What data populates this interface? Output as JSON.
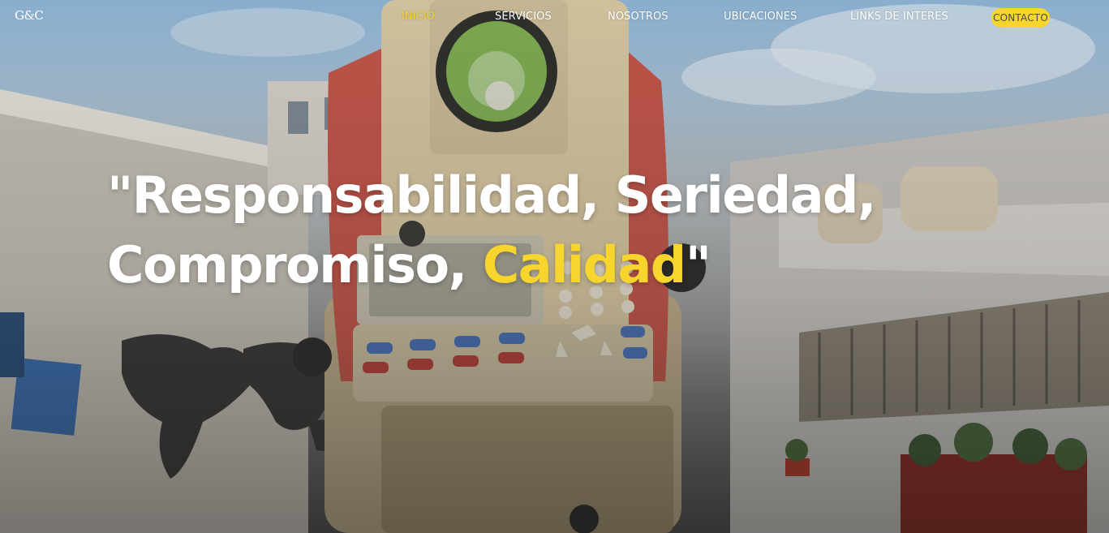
{
  "brand": {
    "logo_text": "G&C"
  },
  "nav": {
    "links": [
      {
        "label": "INICIO",
        "active": true
      },
      {
        "label": "SERVICIOS",
        "active": false
      },
      {
        "label": "NOSOTROS",
        "active": false
      },
      {
        "label": "UBICACIONES",
        "active": false
      },
      {
        "label": "LINKS DE INTERES",
        "active": false
      }
    ],
    "contact_label": "CONTACTO"
  },
  "hero": {
    "line1": "\"Responsabilidad, Seriedad,",
    "line2_start": "Compromiso, ",
    "line2_accent": "Calidad",
    "line2_end": "\""
  },
  "colors": {
    "accent": "#f7d52c",
    "text": "#ffffff",
    "button_text": "#4a4a4a"
  }
}
